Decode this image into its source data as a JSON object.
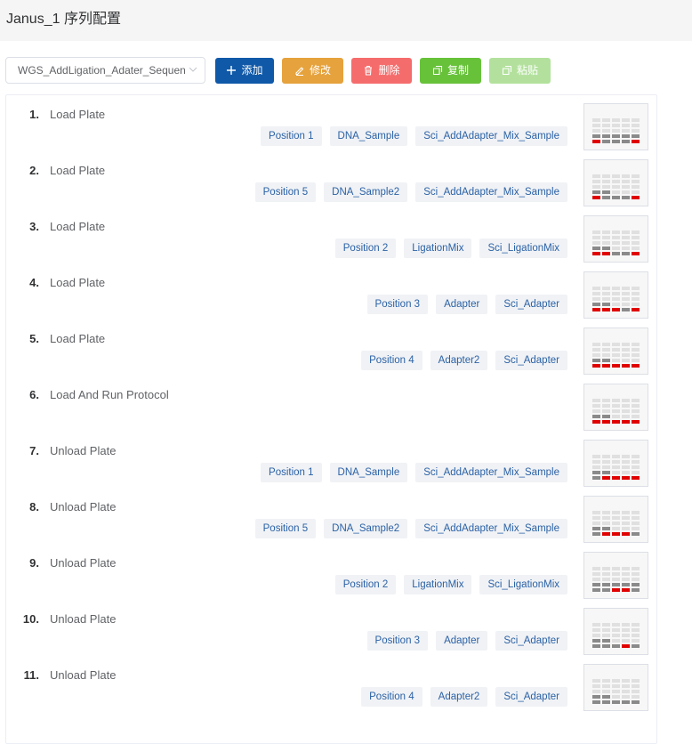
{
  "header": {
    "title": "Janus_1 序列配置"
  },
  "toolbar": {
    "select_value": "WGS_AddLigation_Adater_Sequen",
    "add_label": "添加",
    "edit_label": "修改",
    "delete_label": "删除",
    "copy_label": "复制",
    "paste_label": "粘贴"
  },
  "steps": [
    {
      "num": "1.",
      "name": "Load Plate",
      "tags": [
        "Position 1",
        "DNA_Sample",
        "Sci_AddAdapter_Mix_Sample"
      ]
    },
    {
      "num": "2.",
      "name": "Load Plate",
      "tags": [
        "Position 5",
        "DNA_Sample2",
        "Sci_AddAdapter_Mix_Sample"
      ]
    },
    {
      "num": "3.",
      "name": "Load Plate",
      "tags": [
        "Position 2",
        "LigationMix",
        "Sci_LigationMix"
      ]
    },
    {
      "num": "4.",
      "name": "Load Plate",
      "tags": [
        "Position 3",
        "Adapter",
        "Sci_Adapter"
      ]
    },
    {
      "num": "5.",
      "name": "Load Plate",
      "tags": [
        "Position 4",
        "Adapter2",
        "Sci_Adapter"
      ]
    },
    {
      "num": "6.",
      "name": "Load And Run Protocol",
      "tags": []
    },
    {
      "num": "7.",
      "name": "Unload Plate",
      "tags": [
        "Position 1",
        "DNA_Sample",
        "Sci_AddAdapter_Mix_Sample"
      ]
    },
    {
      "num": "8.",
      "name": "Unload Plate",
      "tags": [
        "Position 5",
        "DNA_Sample2",
        "Sci_AddAdapter_Mix_Sample"
      ]
    },
    {
      "num": "9.",
      "name": "Unload Plate",
      "tags": [
        "Position 2",
        "LigationMix",
        "Sci_LigationMix"
      ]
    },
    {
      "num": "10.",
      "name": "Unload Plate",
      "tags": [
        "Position 3",
        "Adapter",
        "Sci_Adapter"
      ]
    },
    {
      "num": "11.",
      "name": "Unload Plate",
      "tags": [
        "Position 4",
        "Adapter2",
        "Sci_Adapter"
      ]
    }
  ],
  "plates": [
    [
      "00000",
      "00000",
      "00000",
      "11111",
      "21112"
    ],
    [
      "00000",
      "00000",
      "00000",
      "11000",
      "21112"
    ],
    [
      "00000",
      "00000",
      "00000",
      "11000",
      "22112"
    ],
    [
      "00000",
      "00000",
      "00000",
      "11000",
      "22212"
    ],
    [
      "00000",
      "00000",
      "00000",
      "11000",
      "22222"
    ],
    [
      "00000",
      "00000",
      "00000",
      "11000",
      "22222"
    ],
    [
      "00000",
      "00000",
      "00000",
      "11000",
      "12222"
    ],
    [
      "00000",
      "00000",
      "00000",
      "11000",
      "12221"
    ],
    [
      "00000",
      "00000",
      "00000",
      "11111",
      "11221"
    ],
    [
      "00000",
      "00000",
      "00000",
      "11000",
      "11121"
    ],
    [
      "00000",
      "00000",
      "00000",
      "11000",
      "11111"
    ]
  ],
  "colors": {
    "empty": "#e0e0e0",
    "filled": "#8a8a8a",
    "active": "#e00000"
  }
}
